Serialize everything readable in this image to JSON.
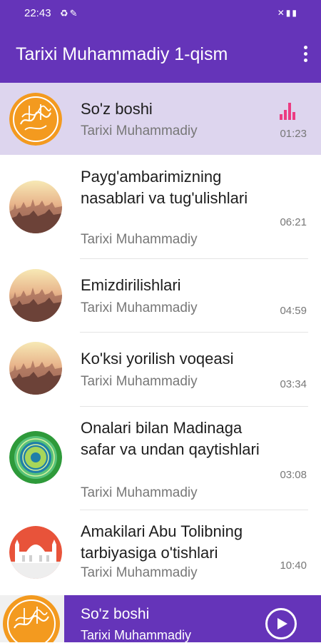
{
  "status_bar": {
    "time": "22:43",
    "left_icons": [
      "recycle-icon",
      "wrench-icon"
    ],
    "right_icons": [
      "mute-icon",
      "signal-icon",
      "battery-icon"
    ]
  },
  "app_bar": {
    "title": "Tarixi Muhammadiy 1-qism",
    "menu_icon": "more-vert-icon"
  },
  "tracks": [
    {
      "title": "So'z boshi",
      "artist": "Tarixi Muhammadiy",
      "duration": "01:23",
      "playing": true,
      "thumb": "calligraphy-icon"
    },
    {
      "title": "Payg'ambarimizning nasablari va tug'ulishlari",
      "artist": "Tarixi Muhammadiy",
      "duration": "06:21",
      "playing": false,
      "thumb": "city-sunset-icon"
    },
    {
      "title": "Emizdirilishlari",
      "artist": "Tarixi Muhammadiy",
      "duration": "04:59",
      "playing": false,
      "thumb": "city-sunset-icon"
    },
    {
      "title": "Ko'ksi yorilish voqeasi",
      "artist": "Tarixi Muhammadiy",
      "duration": "03:34",
      "playing": false,
      "thumb": "city-sunset-icon"
    },
    {
      "title": "Onalari bilan Madinaga safar va undan qaytishlari",
      "artist": "Tarixi Muhammadiy",
      "duration": "03:08",
      "playing": false,
      "thumb": "green-ornament-icon"
    },
    {
      "title": "Amakilari Abu Tolibning tarbiyasiga o'tishlari",
      "artist": "Tarixi Muhammadiy",
      "duration": "10:40",
      "playing": false,
      "thumb": "mosque-icon"
    }
  ],
  "now_playing": {
    "title": "So'z boshi",
    "artist": "Tarixi Muhammadiy",
    "play_icon": "play-icon"
  },
  "colors": {
    "primary": "#6534b9",
    "active_row": "#ddd5ee",
    "equalizer": "#ec3c82"
  }
}
